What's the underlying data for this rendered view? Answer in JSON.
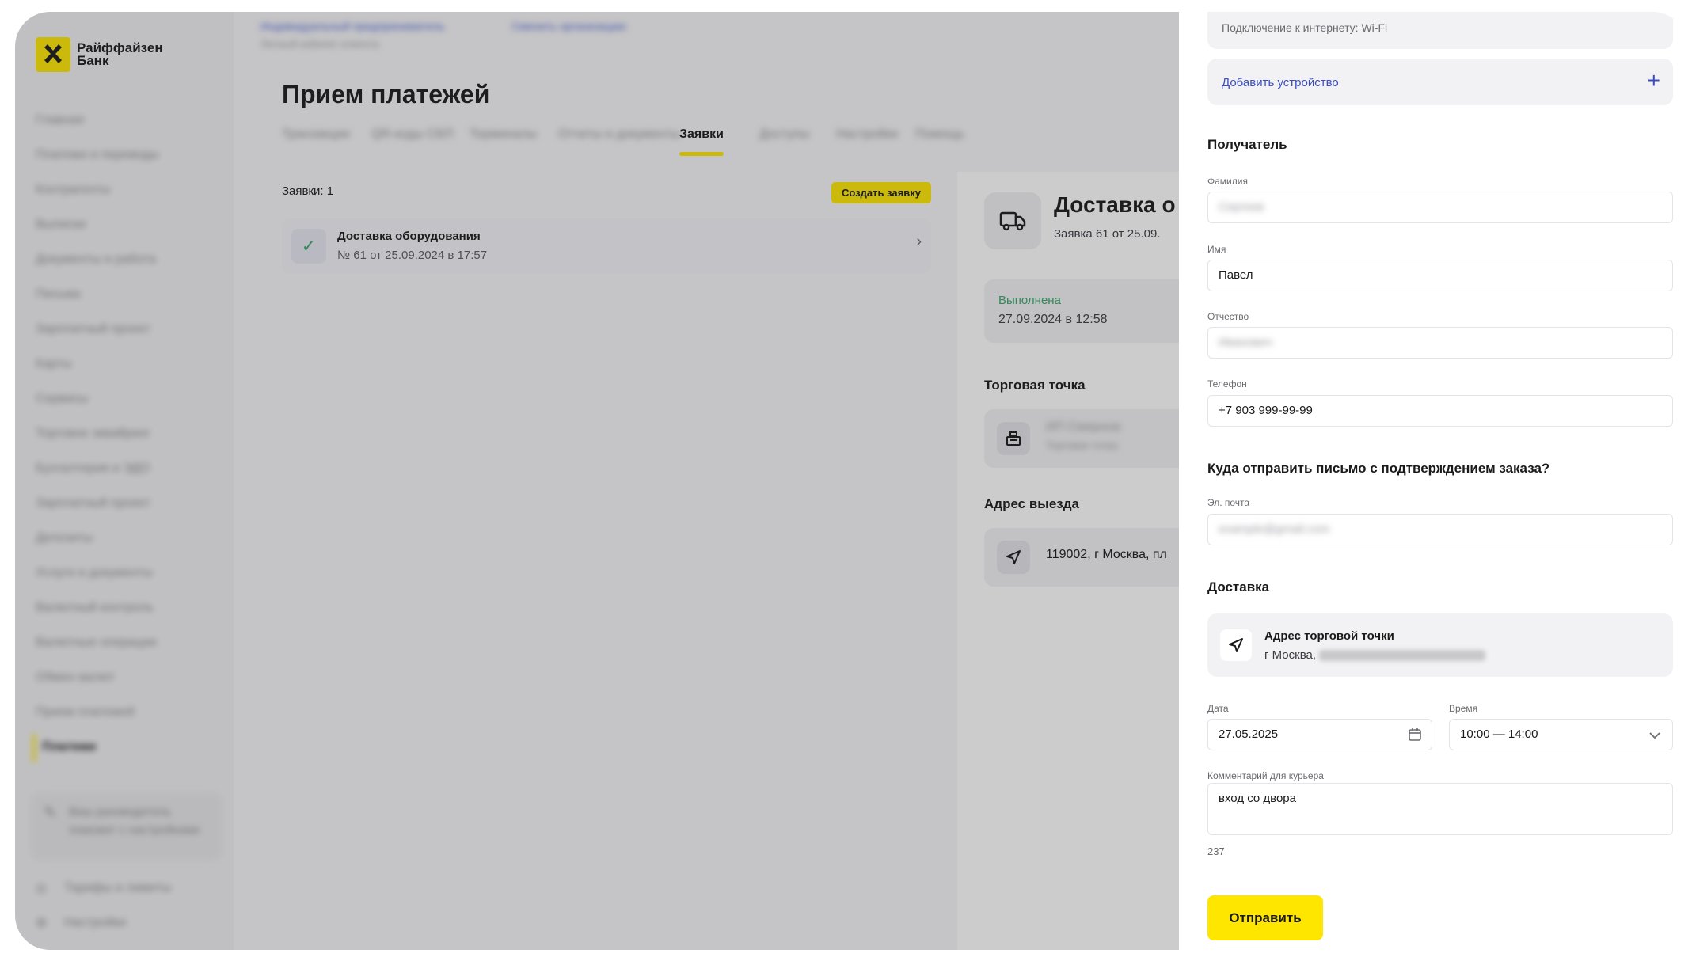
{
  "brand": {
    "name": "Райффайзен Банк",
    "accent": "#fee600"
  },
  "sidebar": {
    "items": [
      {
        "label": "Главная"
      },
      {
        "label": "Платежи и переводы"
      },
      {
        "label": "Контрагенты"
      },
      {
        "label": "Выписки"
      },
      {
        "label": "Документы и работа"
      },
      {
        "label": "Письма"
      },
      {
        "label": "Зарплатный проект"
      },
      {
        "label": "Карты"
      },
      {
        "label": "Сервисы"
      },
      {
        "label": "Торговое эквайринг"
      },
      {
        "label": "Бухгалтерия и ЭДО"
      },
      {
        "label": "Зарплатный проект"
      },
      {
        "label": "Депозиты"
      },
      {
        "label": "Услуги и документы"
      },
      {
        "label": "Валютный контроль"
      },
      {
        "label": "Валютные операции"
      },
      {
        "label": "Обмен валют"
      },
      {
        "label": "Прием платежей"
      },
      {
        "label": "Платежи"
      }
    ],
    "active_index": 18,
    "promo": "Ваш руководитель поможет с настройками",
    "footer_items": [
      {
        "label": "Тарифы и лимиты"
      },
      {
        "label": "Настройки"
      }
    ]
  },
  "topbar": {
    "company": "Индивидуальный предприниматель",
    "company_sub": "Личный кабинет клиента",
    "link": "Сменить организацию"
  },
  "main": {
    "title": "Прием платежей",
    "tabs": [
      {
        "label": "Транзакции"
      },
      {
        "label": "QR-коды СБП"
      },
      {
        "label": "Терминалы"
      },
      {
        "label": "Отчеты и документы"
      },
      {
        "label": "Заявки"
      },
      {
        "label": "Доступы"
      },
      {
        "label": "Настройки"
      },
      {
        "label": "Помощь"
      }
    ],
    "active_tab": 4,
    "count_label": "Заявки: 1",
    "create_button": "Создать заявку",
    "order": {
      "title": "Доставка оборудования",
      "subtitle": "№ 61 от 25.09.2024 в 17:57"
    }
  },
  "details": {
    "title": "Доставка о",
    "subtitle": "Заявка 61 от 25.09.",
    "status": "Выполнена",
    "status_date": "27.09.2024 в 12:58",
    "shop_heading": "Торговая точка",
    "shop_name": "ИП Смирнов",
    "shop_sub": "Торговая точка",
    "address_heading": "Адрес выезда",
    "address": "119002, г Москва, пл"
  },
  "drawer": {
    "wifi": "Подключение к интернету: Wi-Fi",
    "add_device": "Добавить устройство",
    "recipient_heading": "Получатель",
    "surname": {
      "label": "Фамилия",
      "value": "Сергеев"
    },
    "name": {
      "label": "Имя",
      "value": "Павел"
    },
    "patronymic": {
      "label": "Отчество",
      "value": "Иванович"
    },
    "phone": {
      "label": "Телефон",
      "value": "+7 903 999-99-99"
    },
    "email_heading": "Куда отправить письмо с подтверждением заказа?",
    "email": {
      "label": "Эл. почта",
      "value": "example@gmail.com"
    },
    "delivery_heading": "Доставка",
    "shop_address_title": "Адрес торговой точки",
    "shop_address_sub": "г Москва,",
    "date": {
      "label": "Дата",
      "value": "27.05.2025"
    },
    "time": {
      "label": "Время",
      "value": "10:00 — 14:00"
    },
    "comment": {
      "label": "Комментарий для курьера",
      "value": "вход со двора"
    },
    "counter": "237",
    "submit": "Отправить"
  }
}
